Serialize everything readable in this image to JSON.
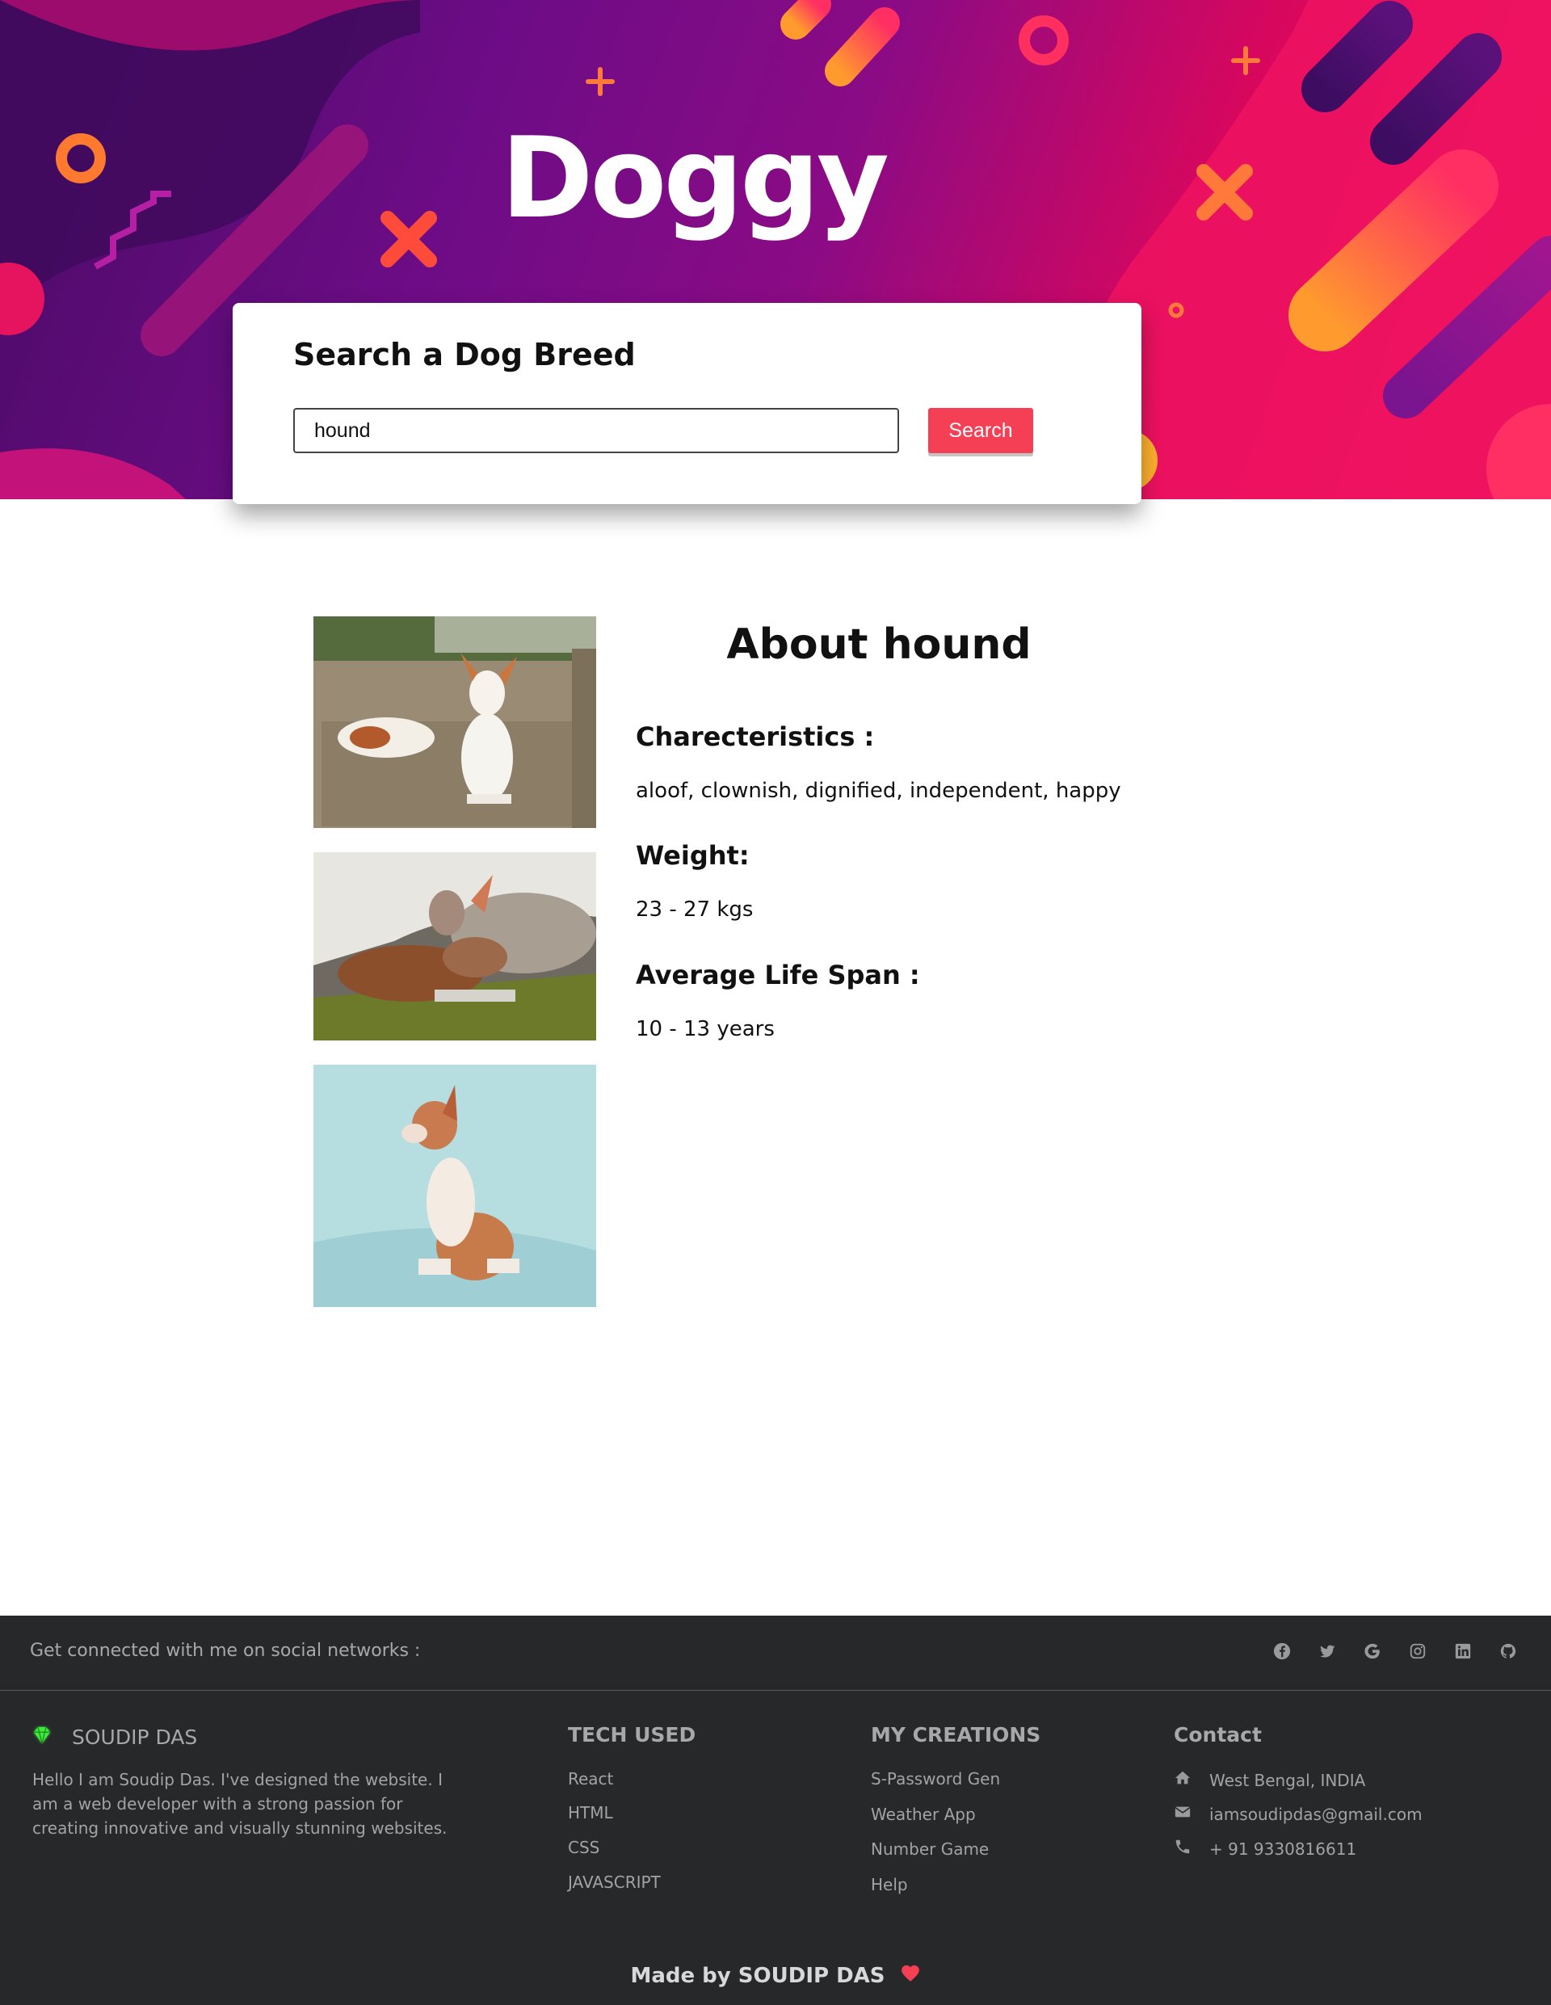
{
  "hero": {
    "title": "Doggy"
  },
  "search": {
    "title": "Search a Dog Breed",
    "value": "hound",
    "button_label": "Search"
  },
  "about": {
    "title": "About hound",
    "characteristics_heading": "Charecteristics :",
    "characteristics_value": "aloof, clownish, dignified, independent, happy",
    "weight_heading": "Weight:",
    "weight_value": "23 - 27 kgs",
    "life_heading": "Average Life Span :",
    "life_value": "10 - 13 years"
  },
  "footer": {
    "social_text": "Get connected with me on social networks :",
    "social_icons": [
      "facebook-icon",
      "twitter-icon",
      "google-icon",
      "instagram-icon",
      "linkedin-icon",
      "github-icon"
    ],
    "brand_name": "SOUDIP DAS",
    "about_text": "Hello I am Soudip Das. I've designed the website. I am a web developer with a strong passion for creating innovative and visually stunning websites.",
    "tech_title": "TECH USED",
    "tech_items": [
      "React",
      "HTML",
      "CSS",
      "JAVASCRIPT"
    ],
    "creations_title": "MY CREATIONS",
    "creations_items": [
      "S-Password Gen",
      "Weather App",
      "Number Game",
      "Help"
    ],
    "contact_title": "Contact",
    "contact_address": "West Bengal, INDIA",
    "contact_email": "iamsoudipdas@gmail.com",
    "contact_phone": "+ 91 9330816611",
    "made_by": "Made by SOUDIP DAS"
  },
  "colors": {
    "accent": "#f43f55",
    "footer_bg": "#27282a",
    "brand_gem": "#3ee83e"
  }
}
